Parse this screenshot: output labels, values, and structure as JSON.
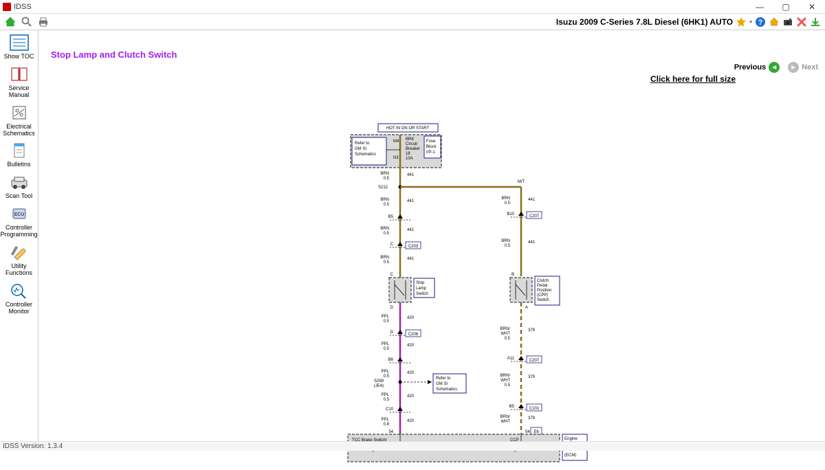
{
  "app": {
    "title": "IDSS",
    "version_label": "IDSS Version: 1.3.4"
  },
  "toolbar": {
    "vehicle": "Isuzu 2009 C-Series 7.8L Diesel (6HK1) AUTO"
  },
  "nav": {
    "previous": "Previous",
    "next": "Next"
  },
  "page": {
    "title": "Stop Lamp and Clutch Switch",
    "fullsize_link": "Click here for full size"
  },
  "sidebar": {
    "items": [
      {
        "label": "Show TOC"
      },
      {
        "label": "Service Manual"
      },
      {
        "label": "Electrical Schematics"
      },
      {
        "label": "Bulletins"
      },
      {
        "label": "Scan Tool"
      },
      {
        "label": "Controller Programming"
      },
      {
        "label": "Utility Functions"
      },
      {
        "label": "Controller Monitor"
      }
    ]
  },
  "diagram": {
    "header": "HOT IN ON OR START",
    "boxes": {
      "gm_si": "Refer to GM SI Schematics",
      "brk": "BRK Circuit Breaker 18 10A",
      "fuse_block": "Fuse Block I/P-1",
      "stop_lamp_switch": "Stop Lamp Switch",
      "cpp_switch": "Clutch Pedal Position (CPP) Switch",
      "refer_gm_si": "Refer to GM SI Schematics",
      "ecm": "Engine Control Module (ECM)",
      "tcc": "TCC Brake Switch/ Cruise Control Release Signal",
      "ccp": "CCP Switch Signal"
    },
    "labels": {
      "mt": "M/T",
      "brn": "BRN",
      "ppl": "PPL",
      "brn_wht": "BRN/ WHT",
      "size05": "0.5",
      "size08": "0.8",
      "w441": "441",
      "w420": "420",
      "w379": "379",
      "S212": "S212",
      "S269": "S269 (JE4)",
      "M4": "M4",
      "N3": "N3",
      "B5": "B5",
      "B6": "B6",
      "B10": "B10",
      "A11": "A11",
      "C": "C",
      "D": "D",
      "n54": "54",
      "C10": "C10",
      "A": "A",
      "B": "B",
      "C203": "C203",
      "C206": "C206",
      "C207": "C207",
      "C101": "C101",
      "E6": "E6"
    }
  }
}
